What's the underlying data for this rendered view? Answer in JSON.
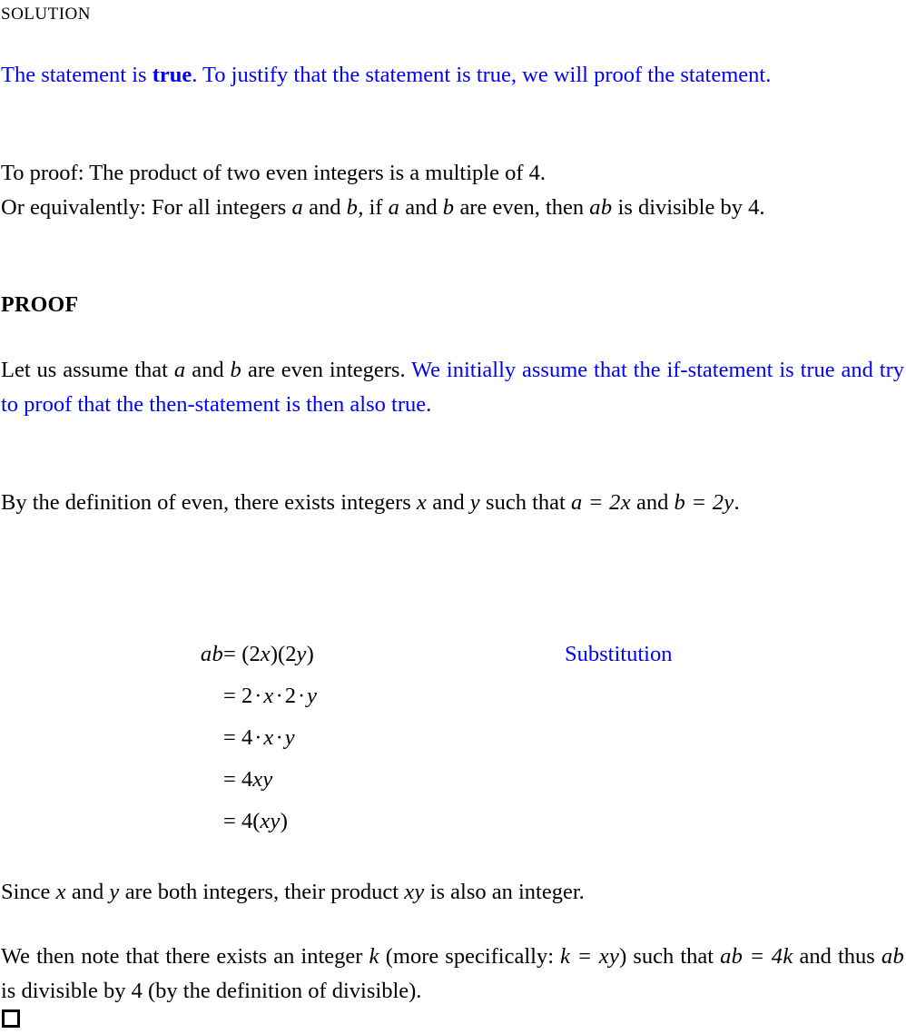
{
  "document": {
    "title": "SOLUTION",
    "proof_heading": "PROOF",
    "colors": {
      "body_text": "#000000",
      "annotation_blue": "#0000ff"
    },
    "statement_paragraph": {
      "black_prefix": "",
      "blue_run_1": "The statement is ",
      "blue_bold": "true",
      "blue_run_2": ". To justify that the statement is true, we will proof the statement."
    },
    "to_proof_line": "To proof: The product of two even integers is a multiple of 4.",
    "equivalently_line": {
      "part_1": "Or equivalently: For all integers ",
      "var_a_1": "a",
      "part_2": " and ",
      "var_b_1": "b",
      "part_3": ", if ",
      "var_a_2": "a",
      "part_4": " and ",
      "var_b_2": "b",
      "part_5": " are even, then ",
      "var_ab": "ab",
      "part_6": " is divisible by 4."
    },
    "assume_paragraph": {
      "black_1": "Let us assume that ",
      "var_a": "a",
      "black_2": " and ",
      "var_b": "b",
      "black_3": " are even integers. ",
      "blue": "We initially assume that the if-statement is true and try to proof that the then-statement is then also true."
    },
    "definition_paragraph": {
      "part_1": "By the definition of even, there exists integers ",
      "var_x": "x",
      "part_2": " and ",
      "var_y": "y",
      "part_3": " such that ",
      "eq_a": "a = 2x",
      "part_4": " and ",
      "eq_b": "b = 2y",
      "part_5": "."
    },
    "since_paragraph": {
      "part_1": "Since ",
      "var_x": "x",
      "part_2": " and ",
      "var_y": "y",
      "part_3": " are both integers, their product ",
      "var_xy": "xy",
      "part_4": " is also an integer."
    },
    "note_paragraph": {
      "part_1": "We then note that there exists an integer ",
      "var_k": "k",
      "part_2": " (more specifically: ",
      "eq_k": "k = xy",
      "part_3": ") such that ",
      "eq_abk": "ab = 4k",
      "part_4": " and thus ",
      "var_ab": "ab",
      "part_5": " is divisible by 4 (by the definition of divisible)."
    },
    "qed_symbol": "□"
  },
  "equations": {
    "rows": [
      {
        "lhs": "ab",
        "op": "=",
        "rhs": "(2x)(2y)",
        "note": "Substitution"
      },
      {
        "lhs": "",
        "op": "=",
        "rhs": "2 · x · 2 · y",
        "note": ""
      },
      {
        "lhs": "",
        "op": "=",
        "rhs": "4 · x · y",
        "note": ""
      },
      {
        "lhs": "",
        "op": "=",
        "rhs": "4xy",
        "note": ""
      },
      {
        "lhs": "",
        "op": "=",
        "rhs": "4(xy)",
        "note": ""
      }
    ],
    "row_1": {
      "lhs": "ab",
      "rhs_open": "(",
      "rhs_2a": "2",
      "rhs_xa": "x",
      "rhs_mid": ")(",
      "rhs_2b": "2",
      "rhs_yb": "y",
      "rhs_close": ")",
      "note": "Substitution"
    },
    "row_2": {
      "n1": "2",
      "x": "x",
      "n2": "2",
      "y": "y"
    },
    "row_3": {
      "n1": "4",
      "x": "x",
      "y": "y"
    },
    "row_4": {
      "n1": "4",
      "xy": "xy"
    },
    "row_5": {
      "n1": "4",
      "open": "(",
      "xy": "xy",
      "close": ")"
    },
    "equals_sign": "=",
    "cdot": "·"
  }
}
